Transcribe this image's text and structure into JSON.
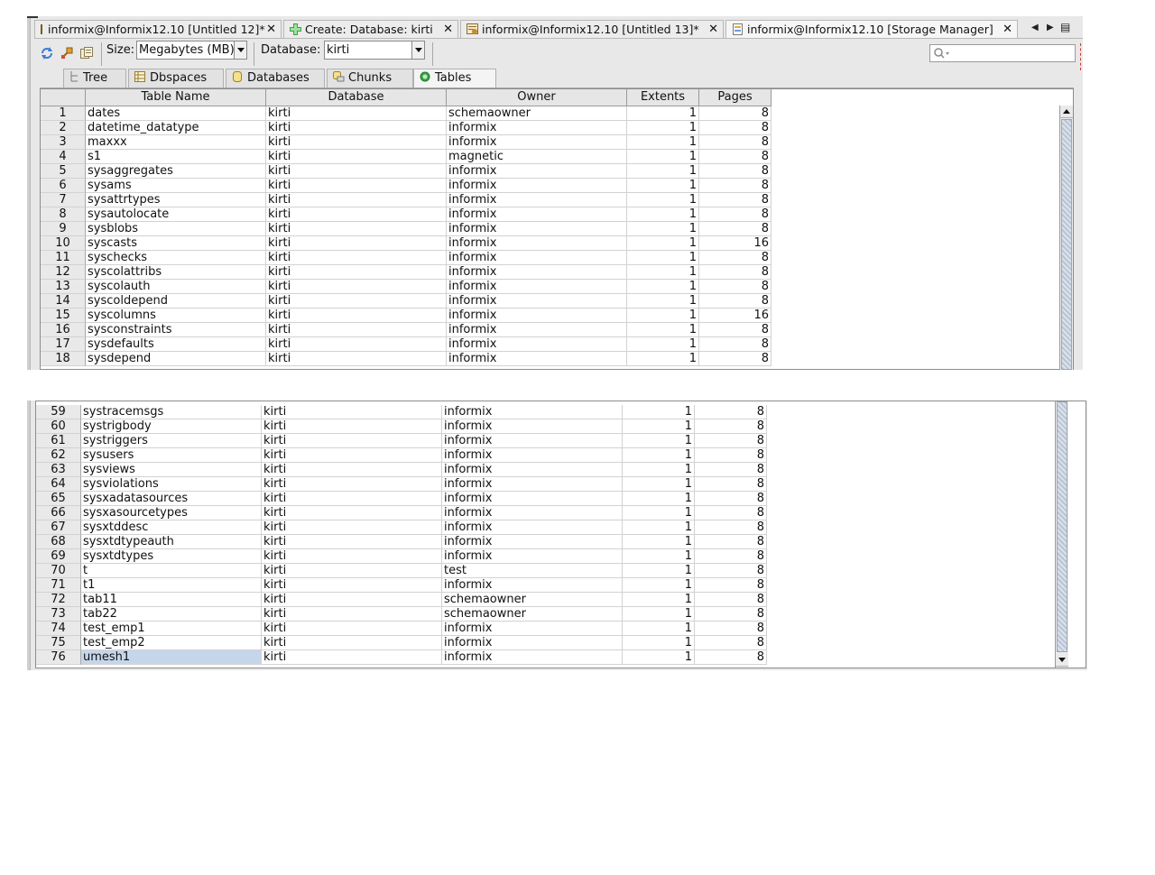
{
  "editor_tabs": [
    {
      "label": "informix@Informix12.10 [Untitled 12]*",
      "icon": "sql-editor-icon",
      "active": false
    },
    {
      "label": "Create: Database: kirti",
      "icon": "create-plus-icon",
      "active": false
    },
    {
      "label": "informix@Informix12.10 [Untitled 13]*",
      "icon": "sql-editor-icon",
      "active": false
    },
    {
      "label": "informix@Informix12.10 [Storage Manager]",
      "icon": "storage-manager-icon",
      "active": true
    }
  ],
  "tab_nav": {
    "prev_icon": "triangle-left-icon",
    "next_icon": "triangle-right-icon",
    "list_icon": "tab-list-icon"
  },
  "toolbar": {
    "size_label": "Size:",
    "size_value": "Megabytes (MB)",
    "database_label": "Database:",
    "database_value": "kirti",
    "search_placeholder": ""
  },
  "view_tabs": [
    {
      "label": "Tree",
      "icon": "tree-icon",
      "active": false
    },
    {
      "label": "Dbspaces",
      "icon": "dbspaces-icon",
      "active": false
    },
    {
      "label": "Databases",
      "icon": "database-icon",
      "active": false
    },
    {
      "label": "Chunks",
      "icon": "chunks-icon",
      "active": false
    },
    {
      "label": "Tables",
      "icon": "tables-icon",
      "active": true
    }
  ],
  "table": {
    "columns": [
      "Table Name",
      "Database",
      "Owner",
      "Extents",
      "Pages"
    ],
    "rows_top": [
      [
        "1",
        "dates",
        "kirti",
        "schemaowner",
        "1",
        "8"
      ],
      [
        "2",
        "datetime_datatype",
        "kirti",
        "informix",
        "1",
        "8"
      ],
      [
        "3",
        "maxxx",
        "kirti",
        "informix",
        "1",
        "8"
      ],
      [
        "4",
        "s1",
        "kirti",
        "magnetic",
        "1",
        "8"
      ],
      [
        "5",
        "sysaggregates",
        "kirti",
        "informix",
        "1",
        "8"
      ],
      [
        "6",
        "sysams",
        "kirti",
        "informix",
        "1",
        "8"
      ],
      [
        "7",
        "sysattrtypes",
        "kirti",
        "informix",
        "1",
        "8"
      ],
      [
        "8",
        "sysautolocate",
        "kirti",
        "informix",
        "1",
        "8"
      ],
      [
        "9",
        "sysblobs",
        "kirti",
        "informix",
        "1",
        "8"
      ],
      [
        "10",
        "syscasts",
        "kirti",
        "informix",
        "1",
        "16"
      ],
      [
        "11",
        "syschecks",
        "kirti",
        "informix",
        "1",
        "8"
      ],
      [
        "12",
        "syscolattribs",
        "kirti",
        "informix",
        "1",
        "8"
      ],
      [
        "13",
        "syscolauth",
        "kirti",
        "informix",
        "1",
        "8"
      ],
      [
        "14",
        "syscoldepend",
        "kirti",
        "informix",
        "1",
        "8"
      ],
      [
        "15",
        "syscolumns",
        "kirti",
        "informix",
        "1",
        "16"
      ],
      [
        "16",
        "sysconstraints",
        "kirti",
        "informix",
        "1",
        "8"
      ],
      [
        "17",
        "sysdefaults",
        "kirti",
        "informix",
        "1",
        "8"
      ],
      [
        "18",
        "sysdepend",
        "kirti",
        "informix",
        "1",
        "8"
      ]
    ],
    "rows_bottom": [
      [
        "59",
        "systracemsgs",
        "kirti",
        "informix",
        "1",
        "8"
      ],
      [
        "60",
        "systrigbody",
        "kirti",
        "informix",
        "1",
        "8"
      ],
      [
        "61",
        "systriggers",
        "kirti",
        "informix",
        "1",
        "8"
      ],
      [
        "62",
        "sysusers",
        "kirti",
        "informix",
        "1",
        "8"
      ],
      [
        "63",
        "sysviews",
        "kirti",
        "informix",
        "1",
        "8"
      ],
      [
        "64",
        "sysviolations",
        "kirti",
        "informix",
        "1",
        "8"
      ],
      [
        "65",
        "sysxadatasources",
        "kirti",
        "informix",
        "1",
        "8"
      ],
      [
        "66",
        "sysxasourcetypes",
        "kirti",
        "informix",
        "1",
        "8"
      ],
      [
        "67",
        "sysxtddesc",
        "kirti",
        "informix",
        "1",
        "8"
      ],
      [
        "68",
        "sysxtdtypeauth",
        "kirti",
        "informix",
        "1",
        "8"
      ],
      [
        "69",
        "sysxtdtypes",
        "kirti",
        "informix",
        "1",
        "8"
      ],
      [
        "70",
        "t",
        "kirti",
        "test",
        "1",
        "8"
      ],
      [
        "71",
        "t1",
        "kirti",
        "informix",
        "1",
        "8"
      ],
      [
        "72",
        "tab11",
        "kirti",
        "schemaowner",
        "1",
        "8"
      ],
      [
        "73",
        "tab22",
        "kirti",
        "schemaowner",
        "1",
        "8"
      ],
      [
        "74",
        "test_emp1",
        "kirti",
        "informix",
        "1",
        "8"
      ],
      [
        "75",
        "test_emp2",
        "kirti",
        "informix",
        "1",
        "8"
      ],
      [
        "76",
        "umesh1",
        "kirti",
        "informix",
        "1",
        "8"
      ]
    ],
    "selected_row": "76"
  },
  "colors": {
    "selection": "#c6d6ea",
    "accent_blue": "#3a7bd5",
    "active_tab_green": "#3aa24a"
  }
}
